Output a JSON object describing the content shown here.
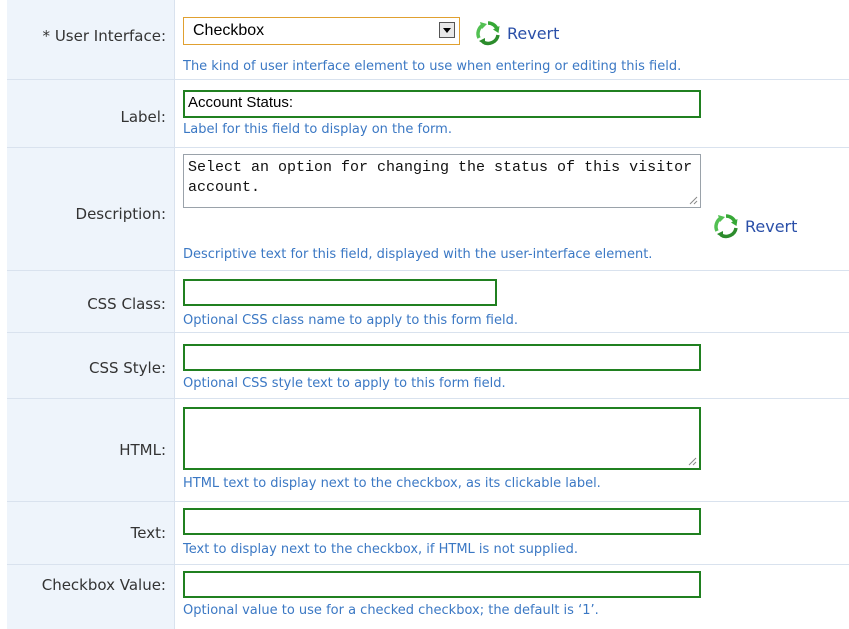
{
  "fields": {
    "user_interface": {
      "required_mark": "*",
      "label": "User Interface:",
      "selected": "Checkbox",
      "revert": "Revert",
      "help": "The kind of user interface element to use when entering or editing this field."
    },
    "label": {
      "label": "Label:",
      "value": "Account Status:",
      "help": "Label for this field to display on the form."
    },
    "description": {
      "label": "Description:",
      "value": "Select an option for changing the status of this visitor account.",
      "revert": "Revert",
      "help": "Descriptive text for this field, displayed with the user-interface element."
    },
    "css_class": {
      "label": "CSS Class:",
      "value": "",
      "help": "Optional CSS class name to apply to this form field."
    },
    "css_style": {
      "label": "CSS Style:",
      "value": "",
      "help": "Optional CSS style text to apply to this form field."
    },
    "html": {
      "label": "HTML:",
      "value": "",
      "help": "HTML text to display next to the checkbox, as its clickable label."
    },
    "text": {
      "label": "Text:",
      "value": "",
      "help": "Text to display next to the checkbox, if HTML is not supplied."
    },
    "checkbox_value": {
      "label": "Checkbox Value:",
      "value": "",
      "help": "Optional value to use for a checked checkbox; the default is ‘1’."
    }
  },
  "colors": {
    "help_text": "#3b78c4",
    "field_border": "#208020",
    "select_border": "#e0a030",
    "revert_link": "#2a4fa8",
    "label_background": "#eef4fb"
  },
  "icons": {
    "revert": "recycle-arrows-icon",
    "textarea_grip": "resize-grip-icon",
    "select_arrow": "chevron-down-icon"
  }
}
